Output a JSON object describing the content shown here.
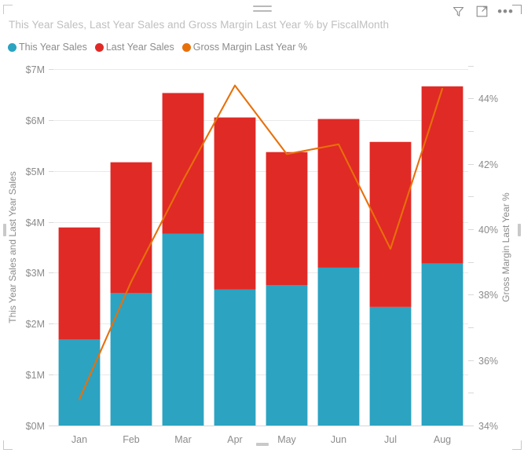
{
  "header": {
    "title": "This Year Sales, Last Year Sales and Gross Margin Last Year % by FiscalMonth",
    "icons": [
      {
        "name": "filter-icon",
        "label": "Filters"
      },
      {
        "name": "focus-mode-icon",
        "label": "Focus mode"
      },
      {
        "name": "more-options-icon",
        "label": "More options"
      }
    ],
    "ellipsis_glyph": "•••"
  },
  "legend": {
    "items": [
      {
        "label": "This Year Sales",
        "color": "#2CA3C1"
      },
      {
        "label": "Last Year Sales",
        "color": "#E02A26"
      },
      {
        "label": "Gross Margin Last Year %",
        "color": "#E8700A"
      }
    ]
  },
  "colors": {
    "this_year_sales": "#2CA3C1",
    "last_year_sales": "#E02A26",
    "gross_margin": "#E8700A",
    "gridline": "#eaeaea",
    "axis_text": "#8c8c8c",
    "title_text": "#bfbfbf",
    "background": "#ffffff"
  },
  "chart_data": {
    "type": "bar",
    "title": "This Year Sales, Last Year Sales and Gross Margin Last Year % by FiscalMonth",
    "xlabel": "",
    "ylabel": "This Year Sales and Last Year Sales",
    "y2label": "Gross Margin Last Year %",
    "stacked": true,
    "grid": true,
    "legend_position": "top-left",
    "categories": [
      "Jan",
      "Feb",
      "Mar",
      "Apr",
      "May",
      "Jun",
      "Jul",
      "Aug"
    ],
    "ylim": [
      0,
      7000000
    ],
    "yticks": [
      0,
      1000000,
      2000000,
      3000000,
      4000000,
      5000000,
      6000000,
      7000000
    ],
    "ytick_labels": [
      "$0M",
      "$1M",
      "$2M",
      "$3M",
      "$4M",
      "$5M",
      "$6M",
      "$7M"
    ],
    "y2lim": [
      34,
      44.9
    ],
    "y2ticks": [
      34,
      36,
      38,
      40,
      42,
      44
    ],
    "y2tick_labels": [
      "34%",
      "36%",
      "38%",
      "40%",
      "42%",
      "44%"
    ],
    "series": [
      {
        "name": "This Year Sales",
        "type": "bar",
        "axis": "left",
        "color": "#2CA3C1",
        "values": [
          1690000,
          2600000,
          3770000,
          2670000,
          2760000,
          3100000,
          2330000,
          3180000
        ]
      },
      {
        "name": "Last Year Sales",
        "type": "bar",
        "axis": "left",
        "color": "#E02A26",
        "values": [
          2200000,
          2570000,
          2760000,
          3380000,
          2610000,
          2920000,
          3240000,
          3480000
        ]
      },
      {
        "name": "Gross Margin Last Year %",
        "type": "line",
        "axis": "right",
        "color": "#E8700A",
        "values": [
          34.8,
          38.4,
          41.5,
          44.4,
          42.3,
          42.6,
          39.4,
          44.3
        ]
      }
    ],
    "totals": [
      3890000,
      5170000,
      6530000,
      6050000,
      5370000,
      6020000,
      5570000,
      6660000
    ]
  }
}
